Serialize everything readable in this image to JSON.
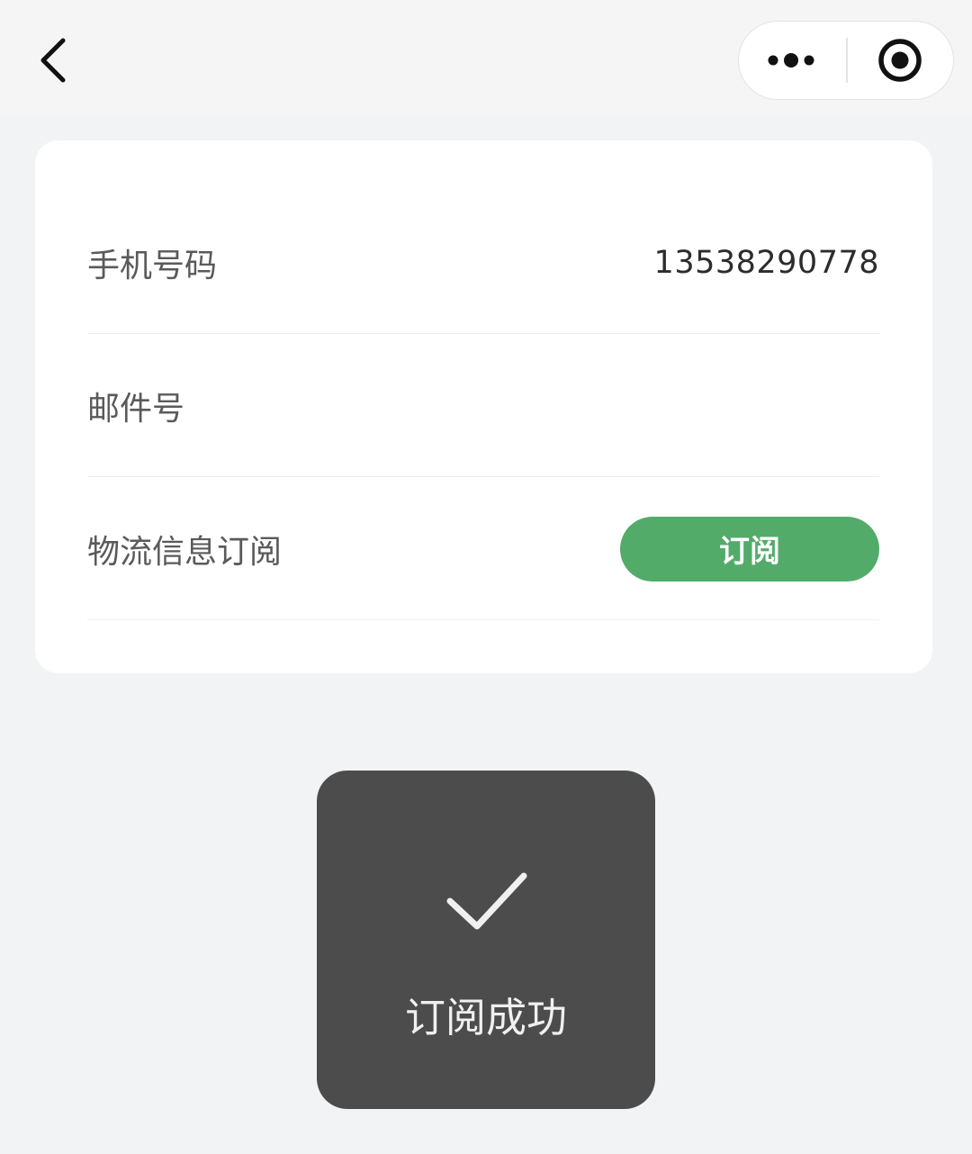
{
  "nav": {
    "back_icon": "chevron-left-icon",
    "more_icon": "ellipsis-icon",
    "close_icon": "target-circle-icon"
  },
  "form": {
    "phone": {
      "label": "手机号码",
      "value": "13538290778"
    },
    "mail": {
      "label": "邮件号",
      "value": ""
    },
    "subscription": {
      "label": "物流信息订阅",
      "button_label": "订阅"
    }
  },
  "toast": {
    "icon": "checkmark-icon",
    "message": "订阅成功"
  },
  "colors": {
    "accent": "#53ab69",
    "toast_bg": "#4c4c4c",
    "page_bg": "#f2f3f5"
  }
}
